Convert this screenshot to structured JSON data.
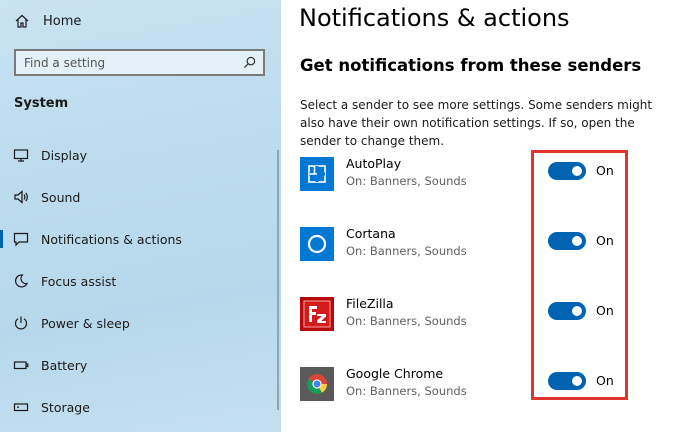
{
  "sidebar": {
    "home_label": "Home",
    "search_placeholder": "Find a setting",
    "section_title": "System",
    "items": [
      {
        "label": "Display",
        "icon": "display-icon"
      },
      {
        "label": "Sound",
        "icon": "sound-icon"
      },
      {
        "label": "Notifications & actions",
        "icon": "notification-icon",
        "active": true
      },
      {
        "label": "Focus assist",
        "icon": "moon-icon"
      },
      {
        "label": "Power & sleep",
        "icon": "power-icon"
      },
      {
        "label": "Battery",
        "icon": "battery-icon"
      },
      {
        "label": "Storage",
        "icon": "storage-icon"
      }
    ]
  },
  "main": {
    "title": "Notifications & actions",
    "subheading": "Get notifications from these senders",
    "description": "Select a sender to see more settings. Some senders might also have their own notification settings. If so, open the sender to change them.",
    "senders": [
      {
        "name": "AutoPlay",
        "status": "On: Banners, Sounds",
        "toggle": "On",
        "icon": "autoplay-icon"
      },
      {
        "name": "Cortana",
        "status": "On: Banners, Sounds",
        "toggle": "On",
        "icon": "cortana-icon"
      },
      {
        "name": "FileZilla",
        "status": "On: Banners, Sounds",
        "toggle": "On",
        "icon": "filezilla-icon"
      },
      {
        "name": "Google Chrome",
        "status": "On: Banners, Sounds",
        "toggle": "On",
        "icon": "chrome-icon"
      }
    ]
  },
  "colors": {
    "accent": "#0063b1",
    "highlight": "#e0342c",
    "sidebar_bg": "#bddcee"
  }
}
